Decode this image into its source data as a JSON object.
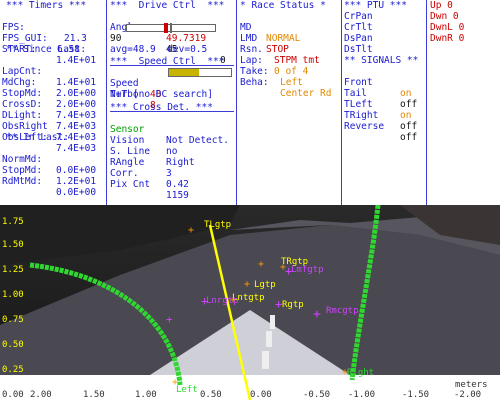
{
  "timers": {
    "title": "*** Timers ***",
    "fps_label": "FPS:",
    "fps_value": "21.3",
    "fpsgui_label": "FPS_GUI:",
    "fpsgui_value": "6.58",
    "start_label": "START:",
    "start_value": "1.4E+01",
    "since_last_title": "** Since Last:",
    "lapcnt_label": "LapCnt:",
    "lapcnt_value": "1.4E+01",
    "mdchg_label": "MdChg:",
    "mdchg_value": "2.0E+00",
    "stopmd_label": "StopMd:",
    "stopmd_value": "2.0E+00",
    "crossd_label": "CrossD:",
    "crossd_value": "7.4E+03",
    "dlight_label": "DLight:",
    "dlight_value": "7.4E+03",
    "obsright_label": "ObsRight",
    "obsright_value": "7.4E+03",
    "obsleft_label": "ObsLeft:",
    "obsleft_value": "7.4E+03",
    "in_last_title": "** In Last:",
    "normmd_label": "NormMd:",
    "normmd_value": "0.0E+00",
    "stopmd2_label": "StopMd:",
    "stopmd2_value": "1.2E+01",
    "rdmtmd_label": "RdMtMd:",
    "rdmtmd_value": "0.0E+00"
  },
  "drive": {
    "title": "***  Drive Ctrl  ***",
    "angle_label": "Angle",
    "angle_value": "49.7319",
    "angle_min": "90",
    "angle_max": "0",
    "angle_center": "45",
    "avg_text": "avg=48.9  dev=0.5",
    "angle_fraction": 0.44,
    "speed_title": "***  Speed Ctrl  ***",
    "speed_label": "Speed",
    "speed_value": "48",
    "speed_fraction": 0.48,
    "turbo_label": "Turbo",
    "turbo_value": "8",
    "nt_text": "N+T [no DC search]",
    "cross_title": "*** Cross Det. ***",
    "sensor_label": "Sensor",
    "sensor_value": "Not Detect.",
    "vision_label": "Vision",
    "vision_value": "no",
    "sline_label": "S. Line",
    "sline_value": "Right",
    "rangle_label": "RAngle",
    "rangle_value": "3",
    "corr_label": "Corr.",
    "corr_value": "0.42",
    "pixcnt_label": "Pix Cnt",
    "pixcnt_value": "1159"
  },
  "race": {
    "title": "* Race Status *",
    "md_label": "MD",
    "md_value": "NORMAL",
    "lmd_label": "LMD",
    "lmd_value": "STOP",
    "rsn_label": "Rsn.",
    "rsn_value": "STPM tmt",
    "lap_label": "Lap:",
    "lap_value": "0 of 4",
    "take_label": "Take:",
    "take_value": "Left",
    "beha_label": "Beha:",
    "beha_value": "Center Rd"
  },
  "ptu": {
    "title": "*** PTU ***",
    "items": [
      "CrPan",
      "CrTlt",
      "DsPan",
      "DsTlt"
    ],
    "signals_title": "** SIGNALS **",
    "signals": [
      {
        "name": "Front",
        "state": "on"
      },
      {
        "name": "Tail",
        "state": "off"
      },
      {
        "name": "TLeft",
        "state": "on"
      },
      {
        "name": "TRight",
        "state": "off"
      },
      {
        "name": "Reverse",
        "state": "off"
      }
    ]
  },
  "keys": {
    "items": [
      "Up 0",
      "Dwn 0",
      "DwnL 0",
      "DwnR 0"
    ]
  },
  "camera": {
    "y_ticks": [
      "1.75",
      "1.50",
      "1.25",
      "1.00",
      "0.75",
      "0.50",
      "0.25",
      "0.00"
    ],
    "x_ticks": [
      "2.00",
      "1.50",
      "1.00",
      "0.50",
      "0.00",
      "-0.50",
      "-1.00",
      "-1.50",
      "-2.00"
    ],
    "units": "meters",
    "labels": {
      "tlgtp": "TLgtp",
      "trgtp": "TRgtp",
      "lmfgtp": "Lmfgtp",
      "lgtp": "Lgtp",
      "lntgtp": "Lntgtp",
      "rgtp": "Rgtp",
      "lnrgtp": "Lnrgtp",
      "rmcgtp": "Rmcgtp",
      "left": "Left",
      "right": "Right"
    },
    "colors": {
      "lane_green": "#2fd82f",
      "yellow_line": "#ffff00",
      "magenta": "#cc44ff",
      "orange": "#ff9900"
    }
  }
}
